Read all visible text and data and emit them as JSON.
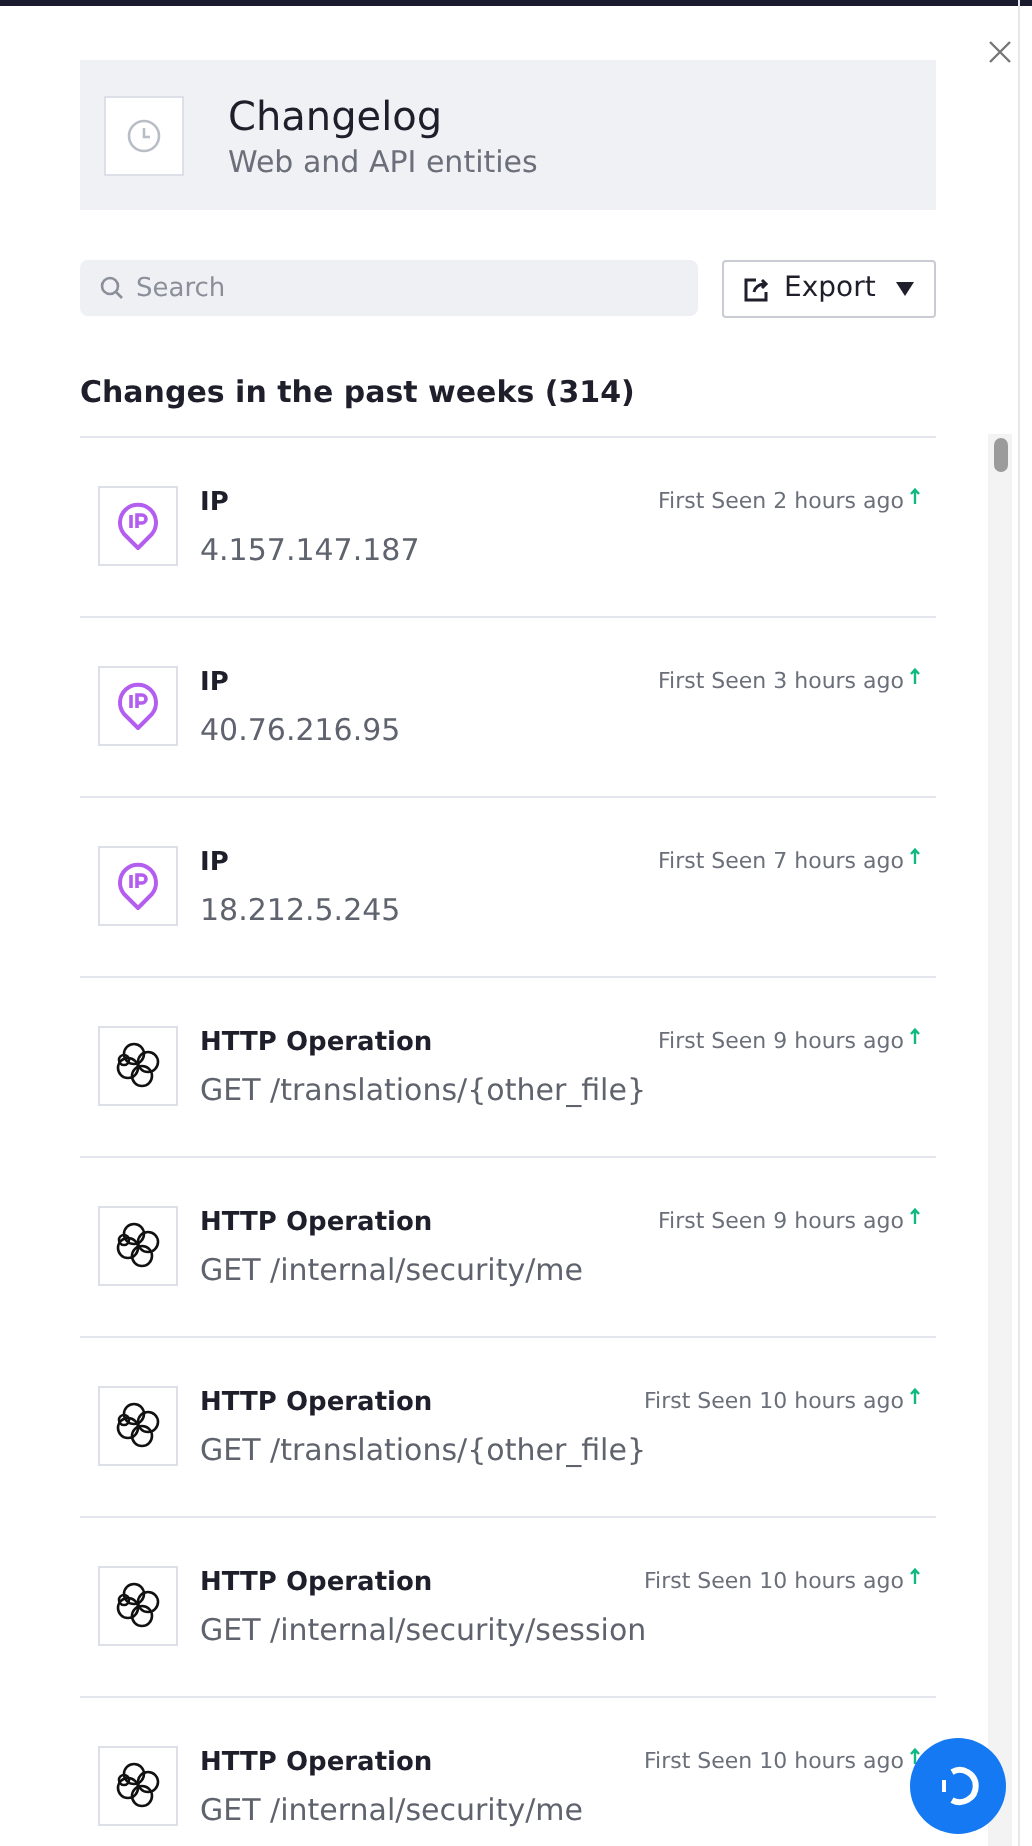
{
  "header": {
    "title": "Changelog",
    "subtitle": "Web and API entities"
  },
  "search": {
    "placeholder": "Search"
  },
  "export_button": {
    "label": "Export"
  },
  "list": {
    "title": "Changes in the past weeks (314)",
    "items": [
      {
        "kind": "ip",
        "type": "IP",
        "value": "4.157.147.187",
        "seen": "First Seen 2 hours ago"
      },
      {
        "kind": "ip",
        "type": "IP",
        "value": "40.76.216.95",
        "seen": "First Seen 3 hours ago"
      },
      {
        "kind": "ip",
        "type": "IP",
        "value": "18.212.5.245",
        "seen": "First Seen 7 hours ago"
      },
      {
        "kind": "http",
        "type": "HTTP Operation",
        "value": "GET /translations/{other_file}",
        "seen": "First Seen 9 hours ago"
      },
      {
        "kind": "http",
        "type": "HTTP Operation",
        "value": "GET /internal/security/me",
        "seen": "First Seen 9 hours ago"
      },
      {
        "kind": "http",
        "type": "HTTP Operation",
        "value": "GET /translations/{other_file}",
        "seen": "First Seen 10 hours ago"
      },
      {
        "kind": "http",
        "type": "HTTP Operation",
        "value": "GET /internal/security/session",
        "seen": "First Seen 10 hours ago"
      },
      {
        "kind": "http",
        "type": "HTTP Operation",
        "value": "GET /internal/security/me",
        "seen": "First Seen 10 hours ago"
      }
    ]
  }
}
